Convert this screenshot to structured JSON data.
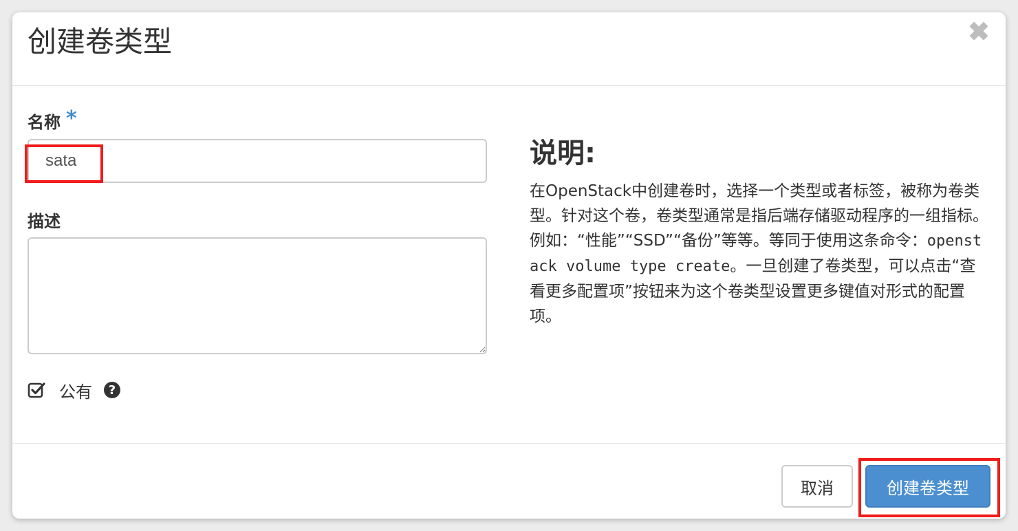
{
  "modal": {
    "title": "创建卷类型",
    "close_label": "✖"
  },
  "form": {
    "name_label": "名称",
    "name_required_mark": "*",
    "name_value": "sata",
    "description_label": "描述",
    "description_value": "",
    "public_checked": true,
    "public_label": "公有"
  },
  "help": {
    "title": "说明:",
    "text_before": "在OpenStack中创建卷时，选择一个类型或者标签，被称为卷类型。针对这个卷，卷类型通常是指后端存储驱动程序的一组指标。例如：“性能”“SSD”“备份”等等。等同于使用这条命令：",
    "command": "openstack volume type create",
    "text_after": "。一旦创建了卷类型，可以点击“查看更多配置项”按钮来为这个卷类型设置更多键值对形式的配置项。"
  },
  "footer": {
    "cancel_label": "取消",
    "submit_label": "创建卷类型"
  },
  "colors": {
    "primary": "#4c8fd0",
    "required": "#428bca",
    "highlight": "#f01b1b"
  },
  "icons": {
    "close": "close-icon",
    "checkbox": "checkbox-checked-icon",
    "help": "question-circle-icon"
  }
}
